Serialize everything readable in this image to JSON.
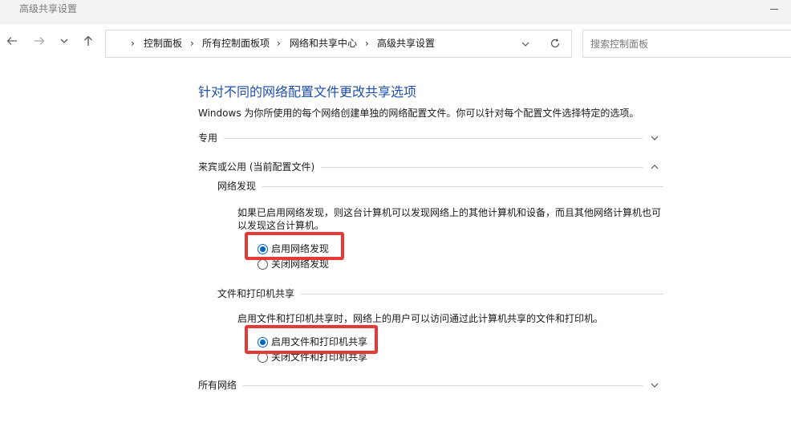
{
  "window": {
    "title": "高级共享设置"
  },
  "toolbar": {
    "back_icon": "back-arrow-icon",
    "forward_icon": "forward-arrow-icon",
    "recent_icon": "chevron-down-icon",
    "up_icon": "up-arrow-icon"
  },
  "breadcrumb": {
    "items": [
      "控制面板",
      "所有控制面板项",
      "网络和共享中心",
      "高级共享设置"
    ],
    "separator": "›"
  },
  "search": {
    "placeholder": "搜索控制面板"
  },
  "main": {
    "title": "针对不同的网络配置文件更改共享选项",
    "description": "Windows 为你所使用的每个网络创建单独的网络配置文件。你可以针对每个配置文件选择特定的选项。",
    "sections": [
      {
        "label": "专用",
        "expanded": false
      },
      {
        "label": "来宾或公用 (当前配置文件)",
        "expanded": true,
        "groups": [
          {
            "label": "网络发现",
            "text": "如果已启用网络发现，则这台计算机可以发现网络上的其他计算机和设备，而且其他网络计算机也可以发现这台计算机。",
            "options": [
              {
                "label": "启用网络发现",
                "checked": true
              },
              {
                "label": "关闭网络发现",
                "checked": false
              }
            ]
          },
          {
            "label": "文件和打印机共享",
            "text": "启用文件和打印机共享时，网络上的用户可以访问通过此计算机共享的文件和打印机。",
            "options": [
              {
                "label": "启用文件和打印机共享",
                "checked": true
              },
              {
                "label": "关闭文件和打印机共享",
                "checked": false
              }
            ]
          }
        ]
      },
      {
        "label": "所有网络",
        "expanded": false
      }
    ]
  },
  "colors": {
    "accent": "#0067c0",
    "title": "#1f4fa8",
    "highlight": "#e53935"
  }
}
